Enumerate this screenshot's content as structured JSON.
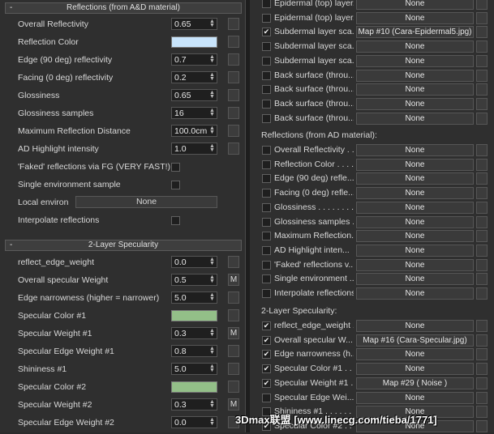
{
  "left": {
    "reflections_rollout": {
      "minus": "-",
      "title": "Reflections (from A&D material)"
    },
    "reflections_rows": [
      {
        "label": "Overall Reflectivity",
        "control": "spinner",
        "value": "0.65",
        "map": ""
      },
      {
        "label": "Reflection Color",
        "control": "color",
        "color": "#c8e4fb",
        "map": ""
      },
      {
        "label": "Edge (90 deg) reflectivity",
        "control": "spinner",
        "value": "0.7",
        "map": ""
      },
      {
        "label": "Facing (0 deg) reflectivity",
        "control": "spinner",
        "value": "0.2",
        "map": ""
      },
      {
        "label": "Glossiness",
        "control": "spinner",
        "value": "0.65",
        "map": ""
      },
      {
        "label": "Glossiness samples",
        "control": "spinner",
        "value": "16",
        "map": ""
      },
      {
        "label": "Maximum Reflection Distance",
        "control": "spinner",
        "value": "100.0cm",
        "map": ""
      },
      {
        "label": "AD Highlight intensity",
        "control": "spinner",
        "value": "1.0",
        "map": ""
      },
      {
        "label": "'Faked' reflections via FG (VERY FAST!)",
        "control": "checkbox"
      },
      {
        "label": "Single environment sample",
        "control": "checkbox"
      },
      {
        "label": "Local environ",
        "control": "button",
        "value": "None"
      },
      {
        "label": "Interpolate reflections",
        "control": "checkbox"
      }
    ],
    "specularity_rollout": {
      "minus": "-",
      "title": "2-Layer Specularity"
    },
    "specularity_rows": [
      {
        "label": "reflect_edge_weight",
        "control": "spinner",
        "value": "0.0",
        "map": ""
      },
      {
        "label": "Overall specular Weight",
        "control": "spinner",
        "value": "0.5",
        "map": "M"
      },
      {
        "label": "Edge narrowness (higher = narrower)",
        "control": "spinner",
        "value": "5.0",
        "map": ""
      },
      {
        "label": "Specular Color #1",
        "control": "color",
        "color": "#93bf88",
        "map": ""
      },
      {
        "label": "Specular Weight #1",
        "control": "spinner",
        "value": "0.3",
        "map": "M"
      },
      {
        "label": "Specular Edge Weight #1",
        "control": "spinner",
        "value": "0.8",
        "map": ""
      },
      {
        "label": "Shininess #1",
        "control": "spinner",
        "value": "5.0",
        "map": ""
      },
      {
        "label": "Specular Color #2",
        "control": "color",
        "color": "#93bf88",
        "map": ""
      },
      {
        "label": "Specular Weight #2",
        "control": "spinner",
        "value": "0.3",
        "map": "M"
      },
      {
        "label": "Specular Edge Weight #2",
        "control": "spinner",
        "value": "0.0",
        "map": ""
      }
    ]
  },
  "right": {
    "top_rows": [
      {
        "label": "Epidermal (top) layer...",
        "checked": false,
        "map": "None"
      },
      {
        "label": "Epidermal (top) layer...",
        "checked": false,
        "map": "None"
      },
      {
        "label": "Subdermal layer sca...",
        "checked": true,
        "map": "Map #10 (Cara-Epidermal5.jpg)"
      },
      {
        "label": "Subdermal layer sca...",
        "checked": false,
        "map": "None"
      },
      {
        "label": "Subdermal layer sca...",
        "checked": false,
        "map": "None"
      },
      {
        "label": "Back surface (throu...",
        "checked": false,
        "map": "None"
      },
      {
        "label": "Back surface (throu...",
        "checked": false,
        "map": "None"
      },
      {
        "label": "Back surface (throu...",
        "checked": false,
        "map": "None"
      },
      {
        "label": "Back surface (throu...",
        "checked": false,
        "map": "None"
      }
    ],
    "reflections_heading": "Reflections (from AD material):",
    "reflection_rows": [
      {
        "label": "Overall Reflectivity . .",
        "checked": false,
        "map": "None"
      },
      {
        "label": "Reflection Color . . . .",
        "checked": false,
        "map": "None"
      },
      {
        "label": "Edge (90 deg) refle...",
        "checked": false,
        "map": "None"
      },
      {
        "label": "Facing (0 deg) refle...",
        "checked": false,
        "map": "None"
      },
      {
        "label": "Glossiness . . . . . . . .",
        "checked": false,
        "map": "None"
      },
      {
        "label": "Glossiness samples . .",
        "checked": false,
        "map": "None"
      },
      {
        "label": "Maximum Reflection...",
        "checked": false,
        "map": "None"
      },
      {
        "label": "AD Highlight inten...",
        "checked": false,
        "map": "None"
      },
      {
        "label": "'Faked' reflections v...",
        "checked": false,
        "map": "None"
      },
      {
        "label": "Single environment ...",
        "checked": false,
        "map": "None"
      },
      {
        "label": "Interpolate reflections",
        "checked": false,
        "map": "None"
      }
    ],
    "specularity_heading": "2-Layer Specularity:",
    "specularity_rows": [
      {
        "label": "reflect_edge_weight . .",
        "checked": true,
        "map": "None"
      },
      {
        "label": "Overall specular W...",
        "checked": true,
        "map": "Map #16 (Cara-Specular.jpg)"
      },
      {
        "label": "Edge narrowness (h...",
        "checked": true,
        "map": "None"
      },
      {
        "label": "Specular Color #1 . .",
        "checked": true,
        "map": "None"
      },
      {
        "label": "Specular Weight #1 .",
        "checked": true,
        "map": "Map #29 ( Noise )"
      },
      {
        "label": "Specular Edge Wei...",
        "checked": false,
        "map": "None"
      },
      {
        "label": "Shininess #1 . . . . . .",
        "checked": false,
        "map": "None"
      },
      {
        "label": "Specular Color #2 . .",
        "checked": true,
        "map": "None"
      }
    ]
  },
  "watermark": "3Dmax联盟 [www.linecg.com/tieba/1771]"
}
